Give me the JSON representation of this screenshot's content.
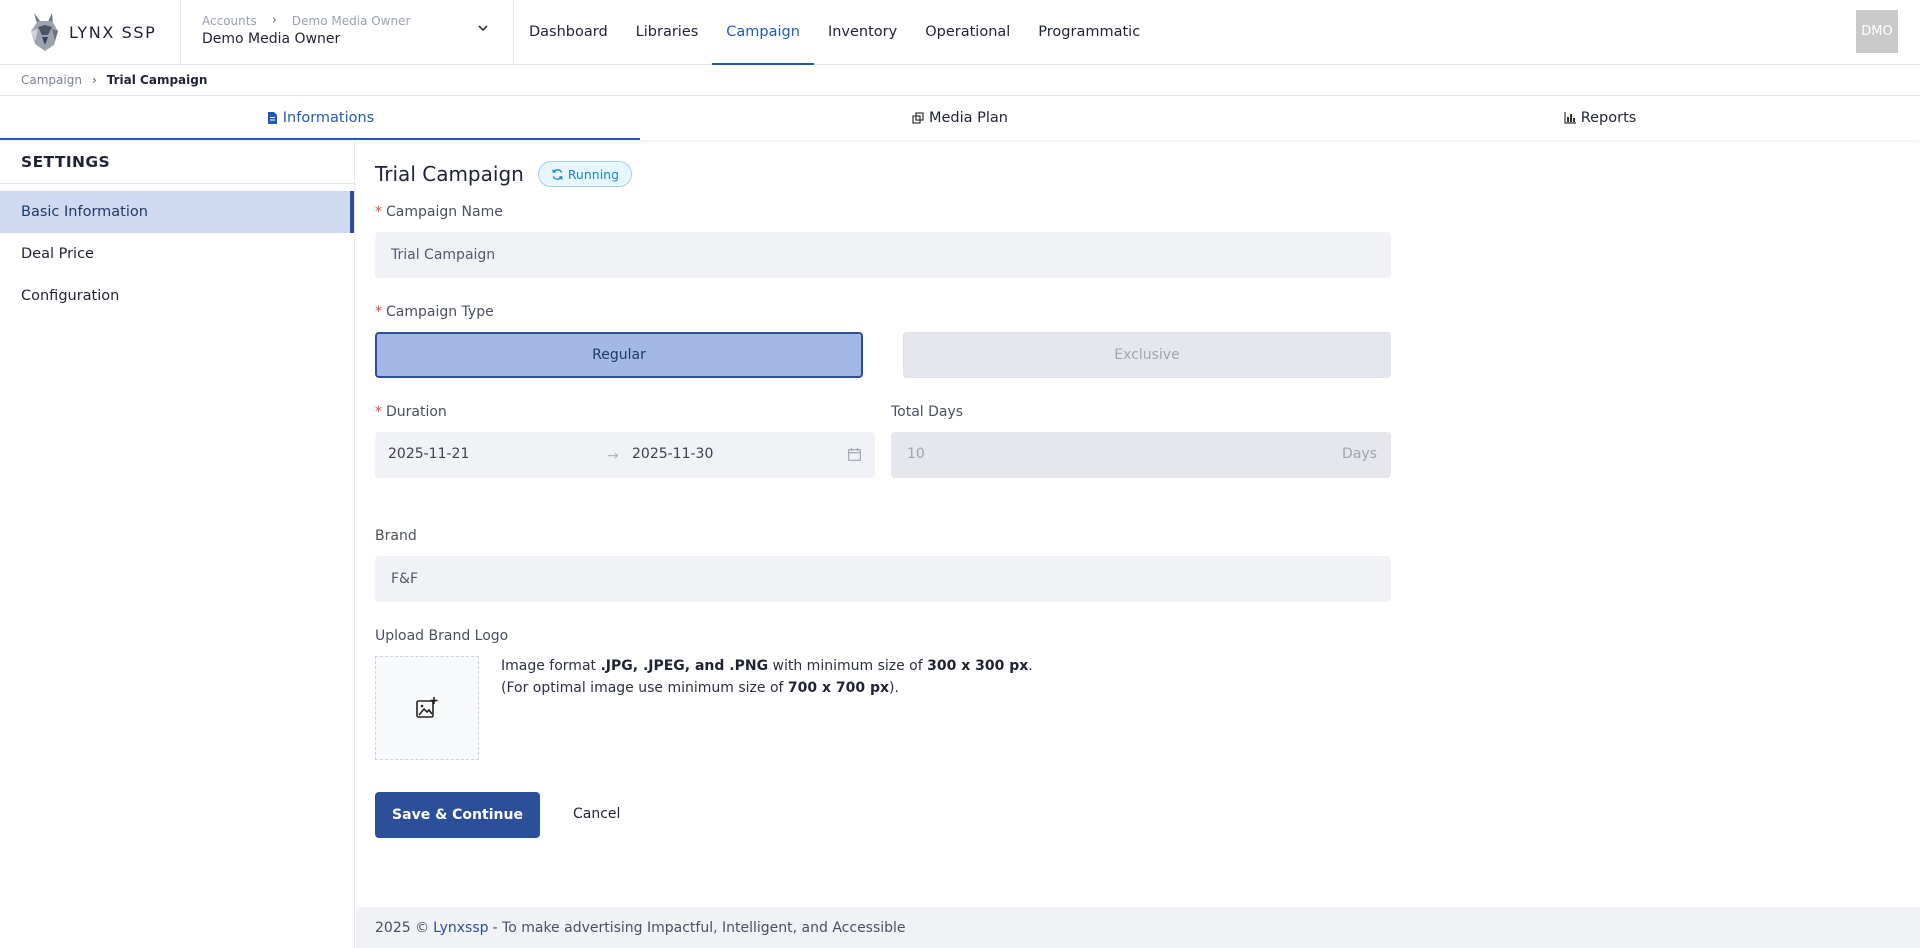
{
  "app": {
    "logo_text": "LYNX SSP"
  },
  "account": {
    "crumb_root": "Accounts",
    "crumb_owner": "Demo Media Owner",
    "name": "Demo Media Owner"
  },
  "nav": [
    "Dashboard",
    "Libraries",
    "Campaign",
    "Inventory",
    "Operational",
    "Programmatic"
  ],
  "nav_active": "Campaign",
  "avatar": "DMO",
  "breadcrumb": {
    "root": "Campaign",
    "current": "Trial Campaign"
  },
  "tabs": [
    "Informations",
    "Media Plan",
    "Reports"
  ],
  "sidebar": {
    "title": "SETTINGS",
    "items": [
      "Basic Information",
      "Deal Price",
      "Configuration"
    ]
  },
  "main": {
    "title": "Trial Campaign",
    "status": "Running",
    "campaign_name_label": "Campaign Name",
    "campaign_name_value": "Trial Campaign",
    "campaign_type_label": "Campaign Type",
    "types": [
      "Regular",
      "Exclusive"
    ],
    "duration_label": "Duration",
    "start_date": "2025-11-21",
    "end_date": "2025-11-30",
    "total_days_label": "Total Days",
    "total_days_value": "10",
    "days_unit": "Days",
    "brand_label": "Brand",
    "brand_value": "F&F",
    "upload_label": "Upload Brand Logo",
    "upload_l1_a": "Image format ",
    "upload_l1_b": ".JPG, .JPEG, and .PNG",
    "upload_l1_c": " with minimum size of ",
    "upload_l1_d": "300 x 300 px",
    "upload_l1_e": ".",
    "upload_l2_a": "(For optimal image use minimum size of ",
    "upload_l2_b": "700 x 700 px",
    "upload_l2_c": ").",
    "save_label": "Save & Continue",
    "cancel_label": "Cancel"
  },
  "footer": {
    "copy": "2025 ©",
    "brand": "Lynxssp",
    "tagline": "- To make advertising Impactful, Intelligent, and Accessible"
  },
  "colors": {
    "primary": "#2c4f9a",
    "accent": "#1e5bb8",
    "active_bg": "#cfdaf2",
    "status": "#1c86c6"
  }
}
